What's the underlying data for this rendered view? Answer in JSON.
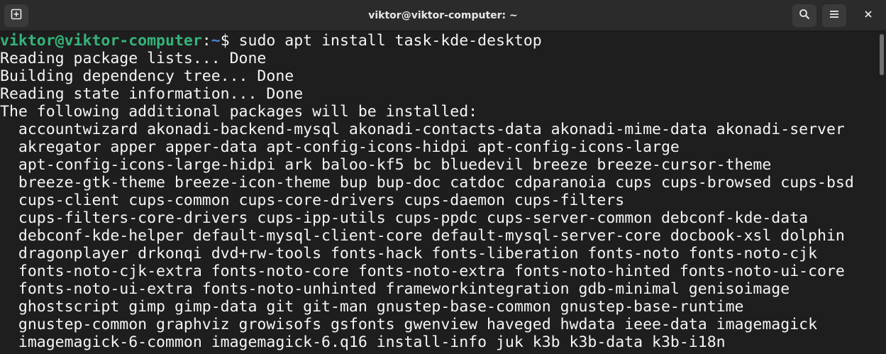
{
  "window": {
    "title": "viktor@viktor-computer: ~"
  },
  "titlebar": {
    "new_tab_icon": "new-tab-icon",
    "search_icon": "search-icon",
    "menu_icon": "hamburger-menu-icon",
    "close_icon": "close-icon"
  },
  "terminal": {
    "prompt": {
      "user_host": "viktor@viktor-computer",
      "separator": ":",
      "path": "~",
      "symbol": "$ ",
      "command": "sudo apt install task-kde-desktop"
    },
    "output_lines": [
      "Reading package lists... Done",
      "Building dependency tree... Done",
      "Reading state information... Done",
      "The following additional packages will be installed:",
      "  accountwizard akonadi-backend-mysql akonadi-contacts-data akonadi-mime-data akonadi-server",
      "  akregator apper apper-data apt-config-icons-hidpi apt-config-icons-large",
      "  apt-config-icons-large-hidpi ark baloo-kf5 bc bluedevil breeze breeze-cursor-theme",
      "  breeze-gtk-theme breeze-icon-theme bup bup-doc catdoc cdparanoia cups cups-browsed cups-bsd",
      "  cups-client cups-common cups-core-drivers cups-daemon cups-filters",
      "  cups-filters-core-drivers cups-ipp-utils cups-ppdc cups-server-common debconf-kde-data",
      "  debconf-kde-helper default-mysql-client-core default-mysql-server-core docbook-xsl dolphin",
      "  dragonplayer drkonqi dvd+rw-tools fonts-hack fonts-liberation fonts-noto fonts-noto-cjk",
      "  fonts-noto-cjk-extra fonts-noto-core fonts-noto-extra fonts-noto-hinted fonts-noto-ui-core",
      "  fonts-noto-ui-extra fonts-noto-unhinted frameworkintegration gdb-minimal genisoimage",
      "  ghostscript gimp gimp-data git git-man gnustep-base-common gnustep-base-runtime",
      "  gnustep-common graphviz growisofs gsfonts gwenview haveged hwdata ieee-data imagemagick",
      "  imagemagick-6-common imagemagick-6.q16 install-info juk k3b k3b-data k3b-i18n"
    ]
  },
  "colors": {
    "terminal_bg": "#1e1e1e",
    "titlebar_bg": "#2b2b2b",
    "text": "#f5f5f5",
    "prompt_user": "#34b47a",
    "prompt_path": "#4f7fd0"
  }
}
